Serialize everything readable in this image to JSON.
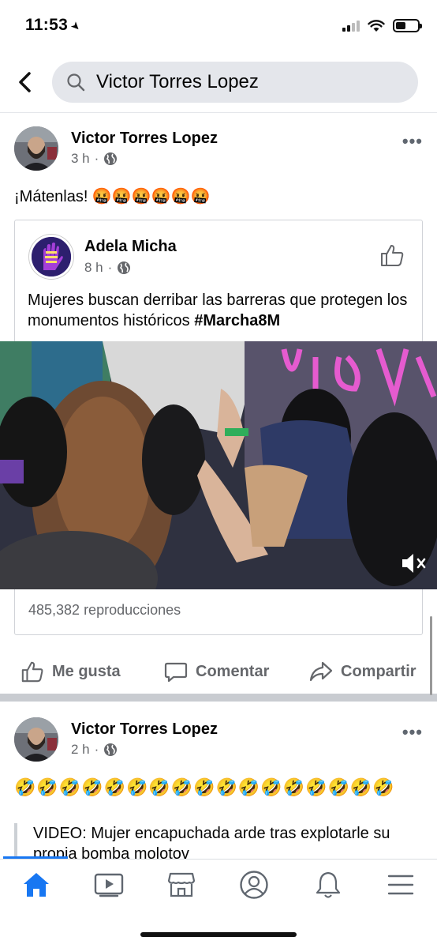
{
  "status": {
    "time": "11:53"
  },
  "search": {
    "query": "Victor Torres Lopez"
  },
  "post1": {
    "author": "Victor Torres Lopez",
    "time": "3 h",
    "separator": "·",
    "text": "¡Mátenlas! 🤬🤬🤬🤬🤬🤬",
    "shared": {
      "author": "Adela Micha",
      "time": "8 h",
      "separator": "·",
      "text": "Mujeres buscan derribar las barreras que protegen los monumentos históricos ",
      "hashtag": "#Marcha8M",
      "views": "485,382 reproducciones"
    },
    "actions": {
      "like": "Me gusta",
      "comment": "Comentar",
      "share": "Compartir"
    }
  },
  "post2": {
    "author": "Victor Torres Lopez",
    "time": "2 h",
    "separator": "·",
    "emojis": "🤣🤣🤣🤣🤣🤣🤣🤣🤣🤣🤣🤣🤣🤣🤣🤣🤣",
    "link_text": "VIDEO: Mujer encapuchada arde tras explotarle su propia bomba molotov"
  },
  "tabs": [
    "home-icon",
    "watch-icon",
    "marketplace-icon",
    "profile-icon",
    "notifications-icon",
    "menu-icon"
  ],
  "colors": {
    "accent": "#1877f2",
    "secondary_text": "#65676b"
  }
}
